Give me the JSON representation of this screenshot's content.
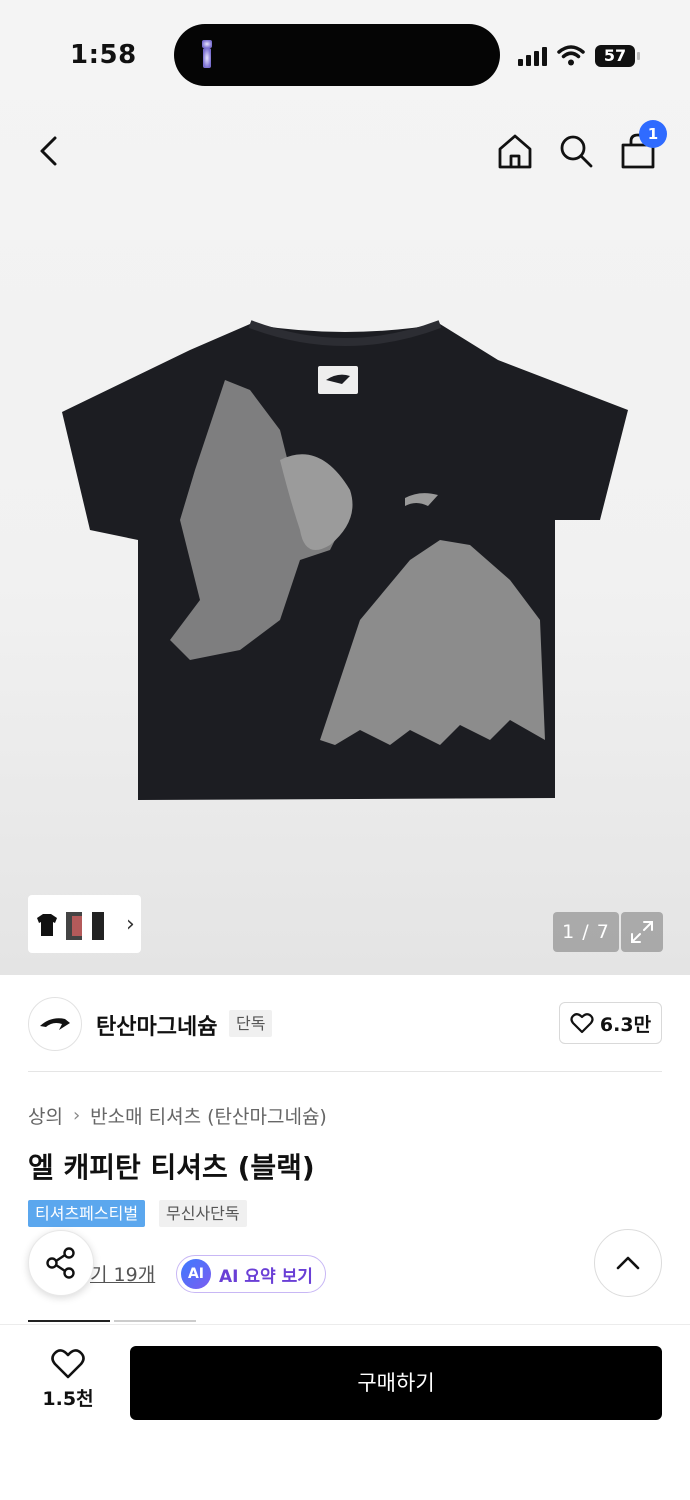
{
  "status_bar": {
    "time": "1:58",
    "battery": "57"
  },
  "nav": {
    "cart_count": "1"
  },
  "gallery": {
    "counter": "1 / 7"
  },
  "brand": {
    "name": "탄산마그네슘",
    "tag": "단독",
    "likes": "6.3만"
  },
  "breadcrumb": {
    "category": "상의",
    "subcategory": "반소매 티셔츠 (탄산마그네슘)"
  },
  "product": {
    "title": "엘 캐피탄 티셔츠 (블랙)",
    "tags": [
      "티셔츠페스티벌",
      "무신사단독"
    ],
    "review_link": "기 19개",
    "ai_badge": "AI",
    "ai_summary": "AI 요약 보기"
  },
  "bottom": {
    "wish_count": "1.5천",
    "buy_label": "구매하기"
  },
  "colors": {
    "accent_blue": "#2f6bff",
    "tag_blue": "#5ba7ee",
    "ai_purple": "#6a3fd6",
    "buy_bg": "#000000"
  }
}
